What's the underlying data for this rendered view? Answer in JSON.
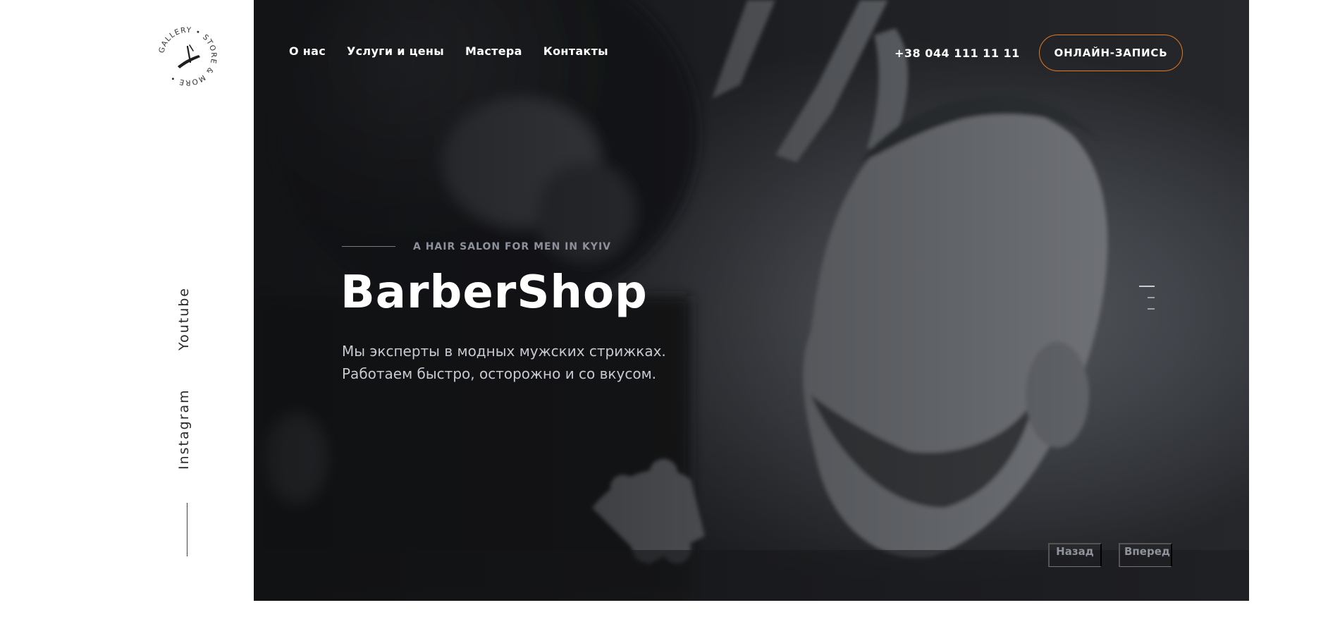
{
  "logo": {
    "ring_text": "GALLERY • STORE & MORE •"
  },
  "social": {
    "youtube": "Youtube",
    "instagram": "Instagram"
  },
  "nav": {
    "items": [
      {
        "label": "О нас"
      },
      {
        "label": "Услуги и цены"
      },
      {
        "label": "Мастера"
      },
      {
        "label": "Контакты"
      }
    ]
  },
  "header": {
    "phone": "+38 044 111 11 11",
    "cta_label": "ОНЛАЙН-ЗАПИСЬ"
  },
  "hero": {
    "kicker": "A HAIR SALON FOR MEN IN KYIV",
    "title": "BarberShop",
    "description": [
      "Мы эксперты в модных мужских стрижках.",
      "Работаем быстро, осторожно и со вкусом."
    ],
    "slides_total": 3,
    "slide_active": 1
  },
  "pager": {
    "prev_label": "Назад",
    "next_label": "Вперед"
  },
  "colors": {
    "accent": "#e07a23",
    "hero_bg": "#24262a",
    "text_light": "#ffffff",
    "text_muted": "#8d919b"
  }
}
